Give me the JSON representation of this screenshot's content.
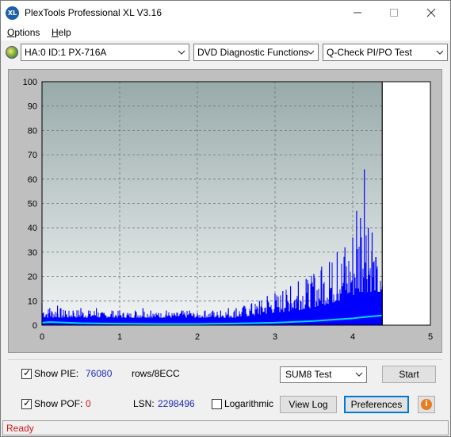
{
  "window": {
    "title": "PlexTools Professional XL V3.16",
    "icon_text": "XL",
    "minimize_icon": "minimize-icon",
    "maximize_icon": "maximize-icon",
    "close_icon": "close-icon"
  },
  "menu": {
    "items": [
      {
        "label": "Options",
        "accel": "O",
        "rest": "ptions"
      },
      {
        "label": "Help",
        "accel": "H",
        "rest": "elp"
      }
    ]
  },
  "toolbar": {
    "drive": "HA:0 ID:1  PX-716A",
    "function": "DVD Diagnostic Functions",
    "test": "Q-Check PI/PO Test"
  },
  "chart_data": {
    "type": "area",
    "title": "",
    "xlabel": "",
    "ylabel": "",
    "xlim": [
      0,
      5
    ],
    "ylim": [
      0,
      100
    ],
    "x_ticks": [
      "0",
      "1",
      "2",
      "3",
      "4",
      "5"
    ],
    "y_ticks": [
      "0",
      "10",
      "20",
      "30",
      "40",
      "50",
      "60",
      "70",
      "80",
      "90",
      "100"
    ],
    "end_marker_x": 4.38,
    "grid": true,
    "legend": "none",
    "colors": {
      "pie": "#0000ff",
      "sum": "#00d7ff",
      "plot_top": "#98aaaa",
      "plot_bottom": "#f2f4f4",
      "empty": "#ffffff"
    },
    "series": [
      {
        "key": "pie_peaks",
        "x": [
          0.0,
          0.1,
          0.2,
          0.3,
          0.4,
          0.5,
          0.6,
          0.7,
          0.8,
          0.9,
          1.0,
          1.1,
          1.2,
          1.3,
          1.4,
          1.5,
          1.6,
          1.7,
          1.8,
          1.9,
          2.0,
          2.1,
          2.2,
          2.3,
          2.4,
          2.5,
          2.6,
          2.7,
          2.8,
          2.9,
          3.0,
          3.1,
          3.2,
          3.3,
          3.4,
          3.5,
          3.6,
          3.7,
          3.8,
          3.9,
          4.0,
          4.05,
          4.1,
          4.15,
          4.2,
          4.25,
          4.3,
          4.38
        ],
        "values": [
          9,
          7,
          8,
          6,
          6,
          7,
          6,
          7,
          5,
          6,
          6,
          5,
          6,
          7,
          6,
          5,
          6,
          5,
          6,
          6,
          5,
          6,
          6,
          6,
          7,
          7,
          8,
          9,
          10,
          12,
          13,
          14,
          16,
          18,
          19,
          21,
          24,
          26,
          30,
          32,
          36,
          47,
          44,
          64,
          40,
          38,
          28,
          16
        ]
      },
      {
        "key": "pie_base",
        "x": [
          0.0,
          0.5,
          1.0,
          1.5,
          2.0,
          2.5,
          2.8,
          3.0,
          3.3,
          3.6,
          3.9,
          4.1,
          4.3,
          4.38
        ],
        "values": [
          3,
          3,
          3,
          3,
          3,
          3,
          4,
          5,
          6,
          8,
          10,
          13,
          14,
          10
        ]
      },
      {
        "key": "sum8",
        "x": [
          0.0,
          0.1,
          0.5,
          1.0,
          1.5,
          2.0,
          2.5,
          3.0,
          3.5,
          4.0,
          4.2,
          4.38
        ],
        "values": [
          1,
          1.3,
          0.8,
          0.6,
          0.5,
          0.5,
          0.7,
          1.0,
          1.7,
          2.8,
          3.5,
          4.0
        ]
      }
    ]
  },
  "panel": {
    "show_pie_label": "Show PIE:",
    "show_pie_checked": true,
    "pie_value": "76080",
    "pie_unit": "rows/8ECC",
    "show_pof_label": "Show POF:",
    "show_pof_checked": true,
    "pof_value": "0",
    "lsn_label": "LSN:",
    "lsn_value": "2298496",
    "logarithmic_label": "Logarithmic",
    "logarithmic_checked": false,
    "test_select": "SUM8 Test",
    "start_button": "Start",
    "view_log_button": "View Log",
    "preferences_button": "Preferences",
    "check_mark": "✓",
    "info_glyph": "i"
  },
  "status": {
    "text": "Ready"
  }
}
